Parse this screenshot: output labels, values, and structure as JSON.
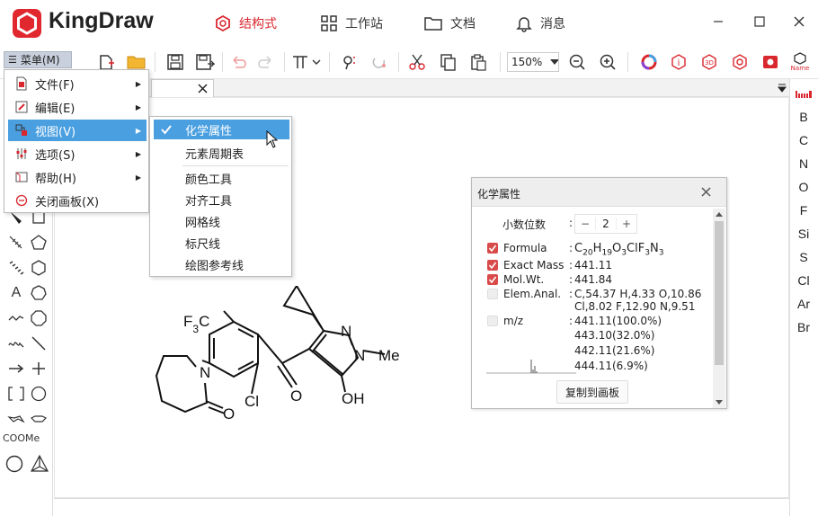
{
  "app": {
    "name": "KingDraw",
    "brand_color": "#e0282e"
  },
  "nav": {
    "structure": "结构式",
    "workstation": "工作站",
    "docs": "文档",
    "messages": "消息"
  },
  "toolbar": {
    "menu_label": "菜单(M)",
    "zoom": "150%"
  },
  "right_elements": [
    "B",
    "C",
    "N",
    "O",
    "F",
    "Si",
    "S",
    "Cl",
    "Ar",
    "Br"
  ],
  "right_name_label": "Name",
  "left_tools": {
    "coome": "COOMe"
  },
  "main_menu": [
    {
      "label": "文件(F)",
      "has_sub": true
    },
    {
      "label": "编辑(E)",
      "has_sub": true
    },
    {
      "label": "视图(V)",
      "has_sub": true,
      "active": true
    },
    {
      "label": "选项(S)",
      "has_sub": true
    },
    {
      "label": "帮助(H)",
      "has_sub": true
    },
    {
      "label": "关闭画板(X)",
      "has_sub": false
    }
  ],
  "view_submenu": [
    "化学属性",
    "元素周期表",
    "颜色工具",
    "对齐工具",
    "网格线",
    "标尺线",
    "绘图参考线"
  ],
  "molecule_labels": {
    "cf3": "F3C",
    "n_ring": "N",
    "o_ketone": "O",
    "cl": "Cl",
    "o_carbonyl": "O",
    "n1": "N",
    "n2": "N",
    "me": "Me",
    "oh": "OH"
  },
  "chem_panel": {
    "title": "化学属性",
    "decimals_label": "小数位数",
    "decimals": "2",
    "formula_label": "Formula",
    "formula": "C20H19O3ClF3N3",
    "exact_mass_label": "Exact Mass",
    "exact_mass": "441.11",
    "mol_wt_label": "Mol.Wt.",
    "mol_wt": "441.84",
    "elem_anal_label": "Elem.Anal.",
    "elem_anal_1": "C,54.37 H,4.33 O,10.86",
    "elem_anal_2": "Cl,8.02 F,12.90 N,9.51",
    "mz_label": "m/z",
    "mz": [
      "441.11(100.0%)",
      "443.10(32.0%)",
      "442.11(21.6%)",
      "444.11(6.9%)"
    ],
    "copy_button": "复制到画板",
    "checked": {
      "formula": true,
      "exact_mass": true,
      "mol_wt": true,
      "elem_anal": false,
      "mz": false
    }
  }
}
